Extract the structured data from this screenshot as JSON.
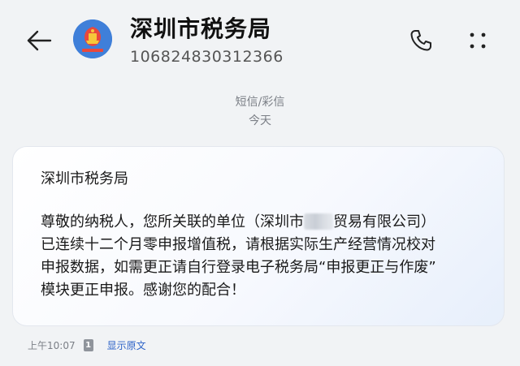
{
  "header": {
    "title": "深圳市税务局",
    "number": "106824830312366",
    "avatar_icon": "tax-bureau-emblem-icon",
    "back_icon": "back-arrow-icon",
    "call_icon": "phone-icon",
    "more_icon": "more-vertical-dots-icon"
  },
  "conversation": {
    "message_type": "短信/彩信",
    "date_label": "今天"
  },
  "message": {
    "sender_line": "深圳市税务局",
    "body_lines": [
      {
        "before": "尊敬的纳税人，您所关联的单位（深圳市",
        "after": "贸易有限公司）"
      },
      "已连续十二个月零申报增值税，请根据实际生产经营情况校对",
      "申报数据，如需更正请自行登录电子税务局“申报更正与作废”",
      "模块更正申报。感谢您的配合！"
    ],
    "time": "上午10:07",
    "sim_slot": "1",
    "show_original_label": "显示原文"
  },
  "colors": {
    "background": "#f1f3f5",
    "avatar_bg": "#3f7fd9",
    "link": "#2d63c8",
    "muted_text": "#7b7f86"
  }
}
